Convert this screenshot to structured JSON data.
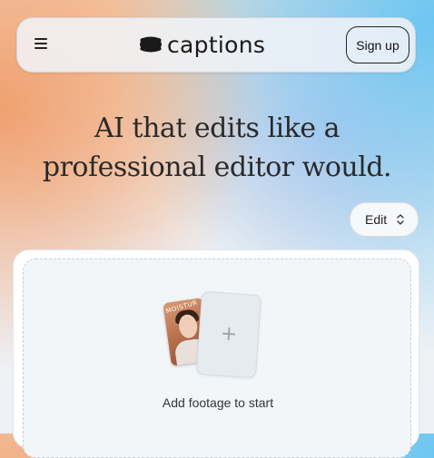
{
  "nav": {
    "menu_icon": "hamburger-menu-icon",
    "logo_icon": "captions-logo-icon",
    "logo_text": "captions",
    "signup_label": "Sign up"
  },
  "hero": {
    "headline_line1": "AI that edits like a",
    "headline_line2": "professional editor would."
  },
  "mode": {
    "selected": "Edit",
    "icon": "chevron-up-down-icon"
  },
  "upload": {
    "thumbnail_text": "MOISTUR",
    "add_icon": "plus-icon",
    "plus_glyph": "+",
    "label": "Add footage to start"
  },
  "colors": {
    "text": "#2a2a2a",
    "panel_bg": "#f3f6f9",
    "accent_orange": "#f0a070",
    "accent_blue": "#6cc6f2"
  }
}
